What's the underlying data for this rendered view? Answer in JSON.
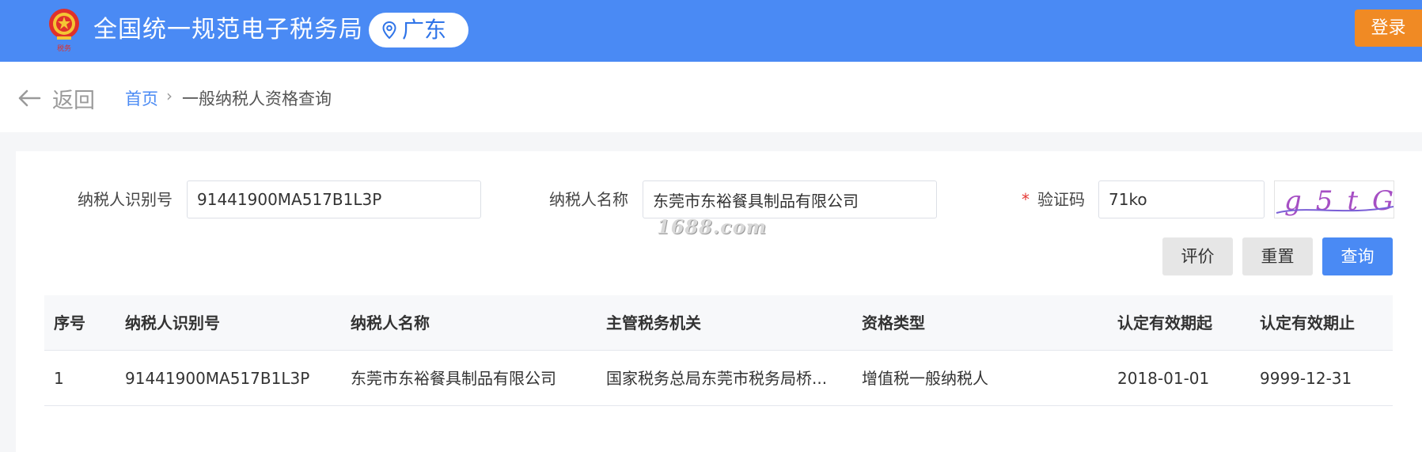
{
  "header": {
    "title": "全国统一规范电子税务局",
    "emblem_icon": "national-emblem-icon",
    "region": "广东",
    "region_icon": "location-pin-icon",
    "login_label": "登录",
    "bg_color": "#4a8af4",
    "login_color": "#f08a24"
  },
  "breadcrumb": {
    "back_label": "返回",
    "back_icon": "arrow-left-icon",
    "home": "首页",
    "separator": "›",
    "current": "一般纳税人资格查询"
  },
  "form": {
    "taxpayer_id": {
      "label": "纳税人识别号",
      "value": "91441900MA517B1L3P"
    },
    "taxpayer_name": {
      "label": "纳税人名称",
      "value": "东莞市东裕餐具制品有限公司"
    },
    "captcha": {
      "required_mark": "*",
      "label": "验证码",
      "value": "71ko",
      "image_text": "g5tG"
    }
  },
  "watermark": "1688.com",
  "buttons": {
    "evaluate": "评价",
    "reset": "重置",
    "query": "查询"
  },
  "table": {
    "headers": [
      "序号",
      "纳税人识别号",
      "纳税人名称",
      "主管税务机关",
      "资格类型",
      "认定有效期起",
      "认定有效期止"
    ],
    "rows": [
      [
        "1",
        "91441900MA517B1L3P",
        "东莞市东裕餐具制品有限公司",
        "国家税务总局东莞市税务局桥...",
        "增值税一般纳税人",
        "2018-01-01",
        "9999-12-31"
      ]
    ]
  }
}
